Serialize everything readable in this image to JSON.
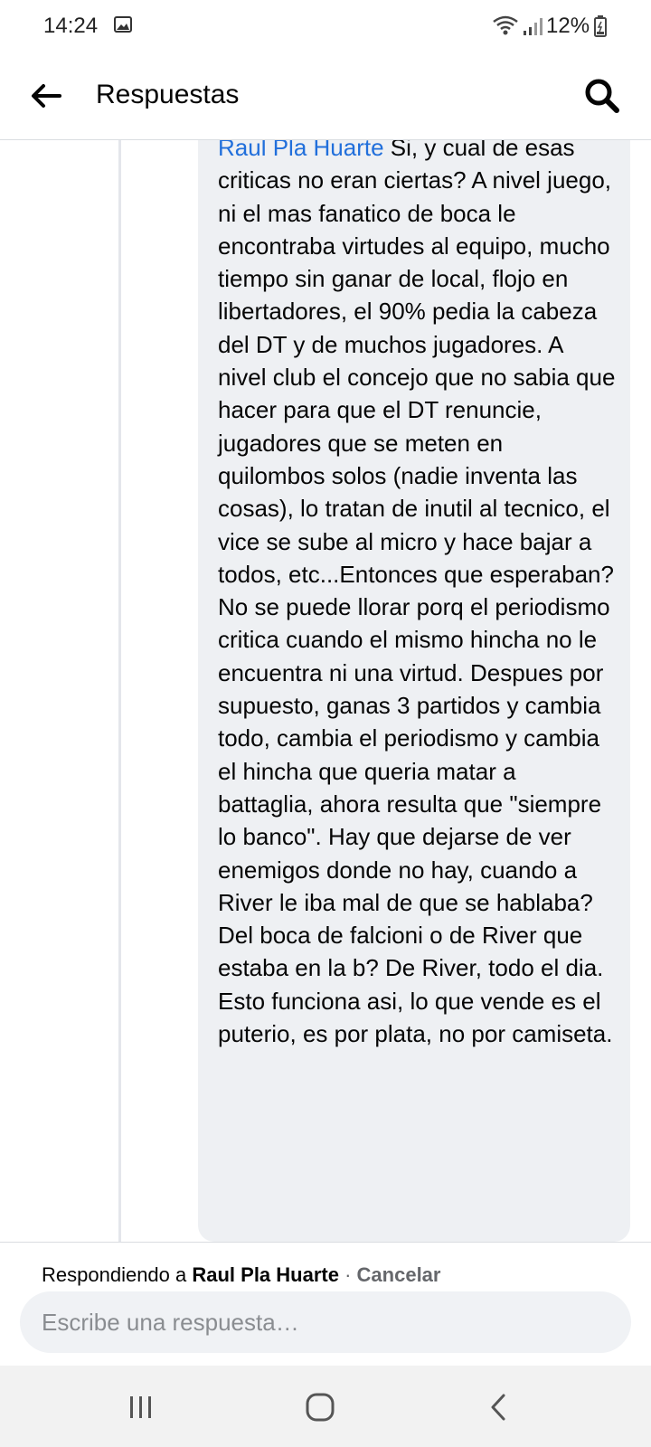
{
  "status_bar": {
    "time": "14:24",
    "battery": "12%",
    "icons": [
      "image-icon",
      "wifi-icon",
      "signal-icon",
      "battery-icon"
    ]
  },
  "header": {
    "title": "Respuestas",
    "icons": [
      "back-arrow-icon",
      "search-icon"
    ]
  },
  "comment": {
    "author": "Raul Pla Huarte",
    "text": "Si, y cual de esas criticas no eran ciertas? A nivel juego, ni el mas fanatico de boca le encontraba virtudes al equipo, mucho tiempo sin ganar de local, flojo en libertadores, el 90% pedia la cabeza del DT y de muchos jugadores. A nivel club el concejo que no sabia que hacer para que el DT renuncie, jugadores que se meten en quilombos solos (nadie inventa las cosas), lo tratan de inutil al tecnico, el vice se sube al micro y hace bajar a todos, etc...Entonces que esperaban? No se puede llorar porq el periodismo critica cuando el mismo hincha no le encuentra ni una virtud. Despues por supuesto, ganas 3 partidos y cambia todo, cambia el periodismo y cambia el hincha que queria matar a battaglia, ahora resulta que \"siempre lo banco\". Hay que dejarse de ver enemigos donde no hay, cuando a River le iba mal de que se hablaba? Del boca de falcioni o de River que estaba en la b? De River, todo el dia. Esto funciona asi, lo que vende es el puterio, es por plata, no por camiseta."
  },
  "reply": {
    "prefix": "Respondiendo a ",
    "target": "Raul Pla Huarte",
    "separator": " · ",
    "cancel": "Cancelar",
    "placeholder": "Escribe una respuesta…"
  },
  "nav_bar": {
    "buttons": [
      "recent-apps-icon",
      "home-icon",
      "back-icon"
    ]
  },
  "colors": {
    "link": "#216fdb",
    "bubble": "#eef0f3",
    "input": "#f0f2f5",
    "nav_bar": "#f2f2f2"
  }
}
